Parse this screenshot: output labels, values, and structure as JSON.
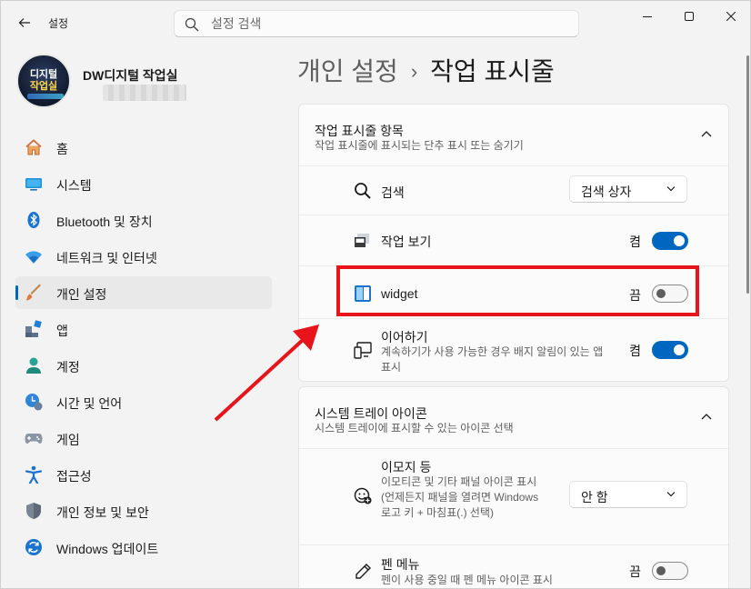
{
  "window": {
    "title": "설정"
  },
  "search": {
    "placeholder": "설정 검색"
  },
  "profile": {
    "name": "DW디지털 작업실",
    "avatar_line1": "디지털",
    "avatar_line2": "작업실"
  },
  "nav": {
    "items": [
      {
        "label": "홈",
        "icon": "home-icon"
      },
      {
        "label": "시스템",
        "icon": "system-icon"
      },
      {
        "label": "Bluetooth 및 장치",
        "icon": "bluetooth-icon"
      },
      {
        "label": "네트워크 및 인터넷",
        "icon": "wifi-icon"
      },
      {
        "label": "개인 설정",
        "icon": "brush-icon",
        "active": true
      },
      {
        "label": "앱",
        "icon": "apps-icon"
      },
      {
        "label": "계정",
        "icon": "account-icon"
      },
      {
        "label": "시간 및 언어",
        "icon": "clock-globe-icon"
      },
      {
        "label": "게임",
        "icon": "gamepad-icon"
      },
      {
        "label": "접근성",
        "icon": "accessibility-icon"
      },
      {
        "label": "개인 정보 및 보안",
        "icon": "shield-icon"
      },
      {
        "label": "Windows 업데이트",
        "icon": "update-icon"
      }
    ]
  },
  "breadcrumb": {
    "parent": "개인 설정",
    "separator": "›",
    "current": "작업 표시줄"
  },
  "taskbar_items": {
    "title": "작업 표시줄 항목",
    "subtitle": "작업 표시줄에 표시되는 단추 표시 또는 숨기기",
    "search": {
      "label": "검색",
      "value": "검색 상자"
    },
    "task_view": {
      "label": "작업 보기",
      "state": "켬",
      "on": true
    },
    "widget": {
      "label": "widget",
      "state": "끔",
      "on": false
    },
    "continue": {
      "label": "이어하기",
      "desc": "계속하기가 사용 가능한 경우 배지 알림이 있는 앱 표시",
      "state": "켬",
      "on": true
    }
  },
  "system_tray": {
    "title": "시스템 트레이 아이콘",
    "subtitle": "시스템 트레이에 표시할 수 있는 아이콘 선택",
    "emoji": {
      "label": "이모지 등",
      "desc": "이모티콘 및 기타 패널 아이콘 표시(언제든지 패널을 열려면 Windows 로고 키 + 마침표(.) 선택)",
      "value": "안 함"
    },
    "pen_menu": {
      "label": "펜 메뉴",
      "desc": "펜이 사용 중일 때 펜 메뉴 아이콘 표시",
      "state": "끔",
      "on": false
    }
  },
  "colors": {
    "accent": "#0067c0",
    "highlight": "#e8141c"
  }
}
